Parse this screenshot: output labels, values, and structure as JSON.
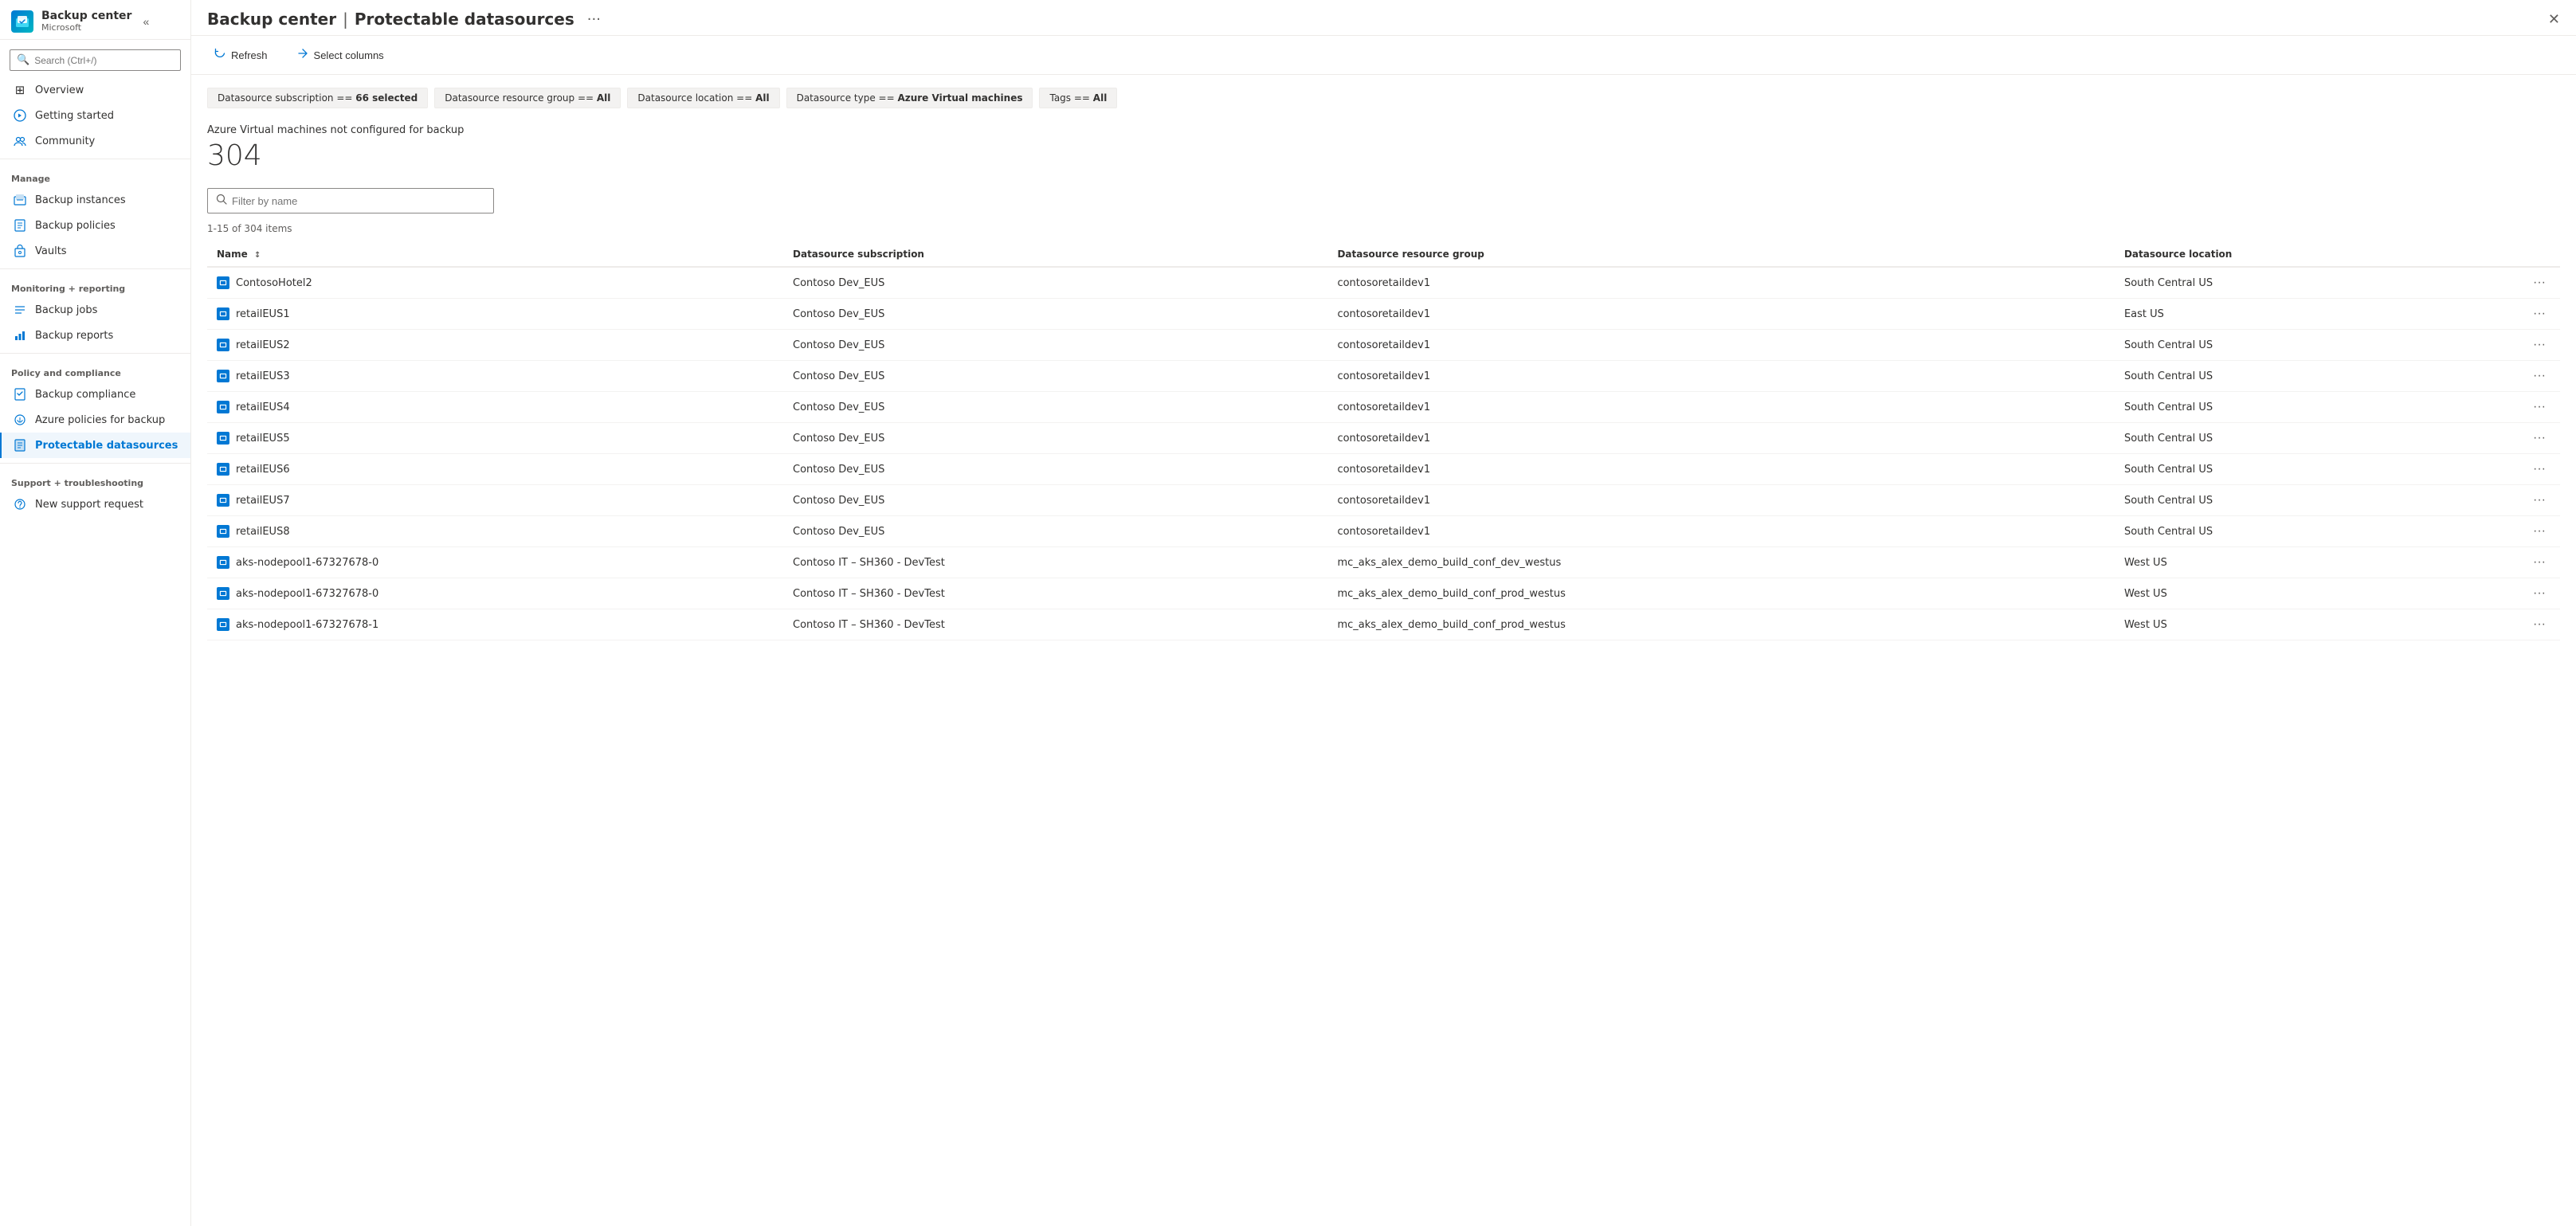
{
  "app": {
    "title": "Backup center",
    "separator": "|",
    "page": "Protectable datasources",
    "subtitle": "Microsoft",
    "more_icon": "···",
    "close_icon": "✕"
  },
  "search": {
    "placeholder": "Search (Ctrl+/)"
  },
  "toolbar": {
    "refresh_label": "Refresh",
    "select_columns_label": "Select columns"
  },
  "filters": [
    {
      "id": "subscription",
      "label": "Datasource subscription == 66 selected"
    },
    {
      "id": "resource_group",
      "label": "Datasource resource group == All"
    },
    {
      "id": "location",
      "label": "Datasource location == All"
    },
    {
      "id": "type",
      "label": "Datasource type == Azure Virtual machines"
    },
    {
      "id": "tags",
      "label": "Tags == All"
    }
  ],
  "stats": {
    "description": "Azure Virtual machines not configured for backup",
    "count": "304"
  },
  "table_search": {
    "placeholder": "Filter by name"
  },
  "items_count": "1-15 of 304 items",
  "columns": [
    {
      "id": "name",
      "label": "Name",
      "sortable": true
    },
    {
      "id": "subscription",
      "label": "Datasource subscription"
    },
    {
      "id": "resource_group",
      "label": "Datasource resource group"
    },
    {
      "id": "location",
      "label": "Datasource location"
    }
  ],
  "rows": [
    {
      "name": "ContosoHotel2",
      "subscription": "Contoso Dev_EUS",
      "resource_group": "contosoretaildev1",
      "location": "South Central US"
    },
    {
      "name": "retailEUS1",
      "subscription": "Contoso Dev_EUS",
      "resource_group": "contosoretaildev1",
      "location": "East US"
    },
    {
      "name": "retailEUS2",
      "subscription": "Contoso Dev_EUS",
      "resource_group": "contosoretaildev1",
      "location": "South Central US"
    },
    {
      "name": "retailEUS3",
      "subscription": "Contoso Dev_EUS",
      "resource_group": "contosoretaildev1",
      "location": "South Central US"
    },
    {
      "name": "retailEUS4",
      "subscription": "Contoso Dev_EUS",
      "resource_group": "contosoretaildev1",
      "location": "South Central US"
    },
    {
      "name": "retailEUS5",
      "subscription": "Contoso Dev_EUS",
      "resource_group": "contosoretaildev1",
      "location": "South Central US"
    },
    {
      "name": "retailEUS6",
      "subscription": "Contoso Dev_EUS",
      "resource_group": "contosoretaildev1",
      "location": "South Central US"
    },
    {
      "name": "retailEUS7",
      "subscription": "Contoso Dev_EUS",
      "resource_group": "contosoretaildev1",
      "location": "South Central US"
    },
    {
      "name": "retailEUS8",
      "subscription": "Contoso Dev_EUS",
      "resource_group": "contosoretaildev1",
      "location": "South Central US"
    },
    {
      "name": "aks-nodepool1-67327678-0",
      "subscription": "Contoso IT – SH360 - DevTest",
      "resource_group": "mc_aks_alex_demo_build_conf_dev_westus",
      "location": "West US"
    },
    {
      "name": "aks-nodepool1-67327678-0",
      "subscription": "Contoso IT – SH360 - DevTest",
      "resource_group": "mc_aks_alex_demo_build_conf_prod_westus",
      "location": "West US"
    },
    {
      "name": "aks-nodepool1-67327678-1",
      "subscription": "Contoso IT – SH360 - DevTest",
      "resource_group": "mc_aks_alex_demo_build_conf_prod_westus",
      "location": "West US"
    }
  ],
  "sidebar": {
    "sections": [
      {
        "items": [
          {
            "id": "overview",
            "label": "Overview",
            "icon": "⊞"
          },
          {
            "id": "getting-started",
            "label": "Getting started",
            "icon": "🚀"
          },
          {
            "id": "community",
            "label": "Community",
            "icon": "👥"
          }
        ]
      },
      {
        "label": "Manage",
        "items": [
          {
            "id": "backup-instances",
            "label": "Backup instances",
            "icon": "🗄"
          },
          {
            "id": "backup-policies",
            "label": "Backup policies",
            "icon": "📋"
          },
          {
            "id": "vaults",
            "label": "Vaults",
            "icon": "🔒"
          }
        ]
      },
      {
        "label": "Monitoring + reporting",
        "items": [
          {
            "id": "backup-jobs",
            "label": "Backup jobs",
            "icon": "≡"
          },
          {
            "id": "backup-reports",
            "label": "Backup reports",
            "icon": "📊"
          }
        ]
      },
      {
        "label": "Policy and compliance",
        "items": [
          {
            "id": "backup-compliance",
            "label": "Backup compliance",
            "icon": "📄"
          },
          {
            "id": "azure-policies",
            "label": "Azure policies for backup",
            "icon": "🔄"
          },
          {
            "id": "protectable-datasources",
            "label": "Protectable datasources",
            "icon": "📑",
            "active": true
          }
        ]
      },
      {
        "label": "Support + troubleshooting",
        "items": [
          {
            "id": "new-support",
            "label": "New support request",
            "icon": "❓"
          }
        ]
      }
    ]
  }
}
